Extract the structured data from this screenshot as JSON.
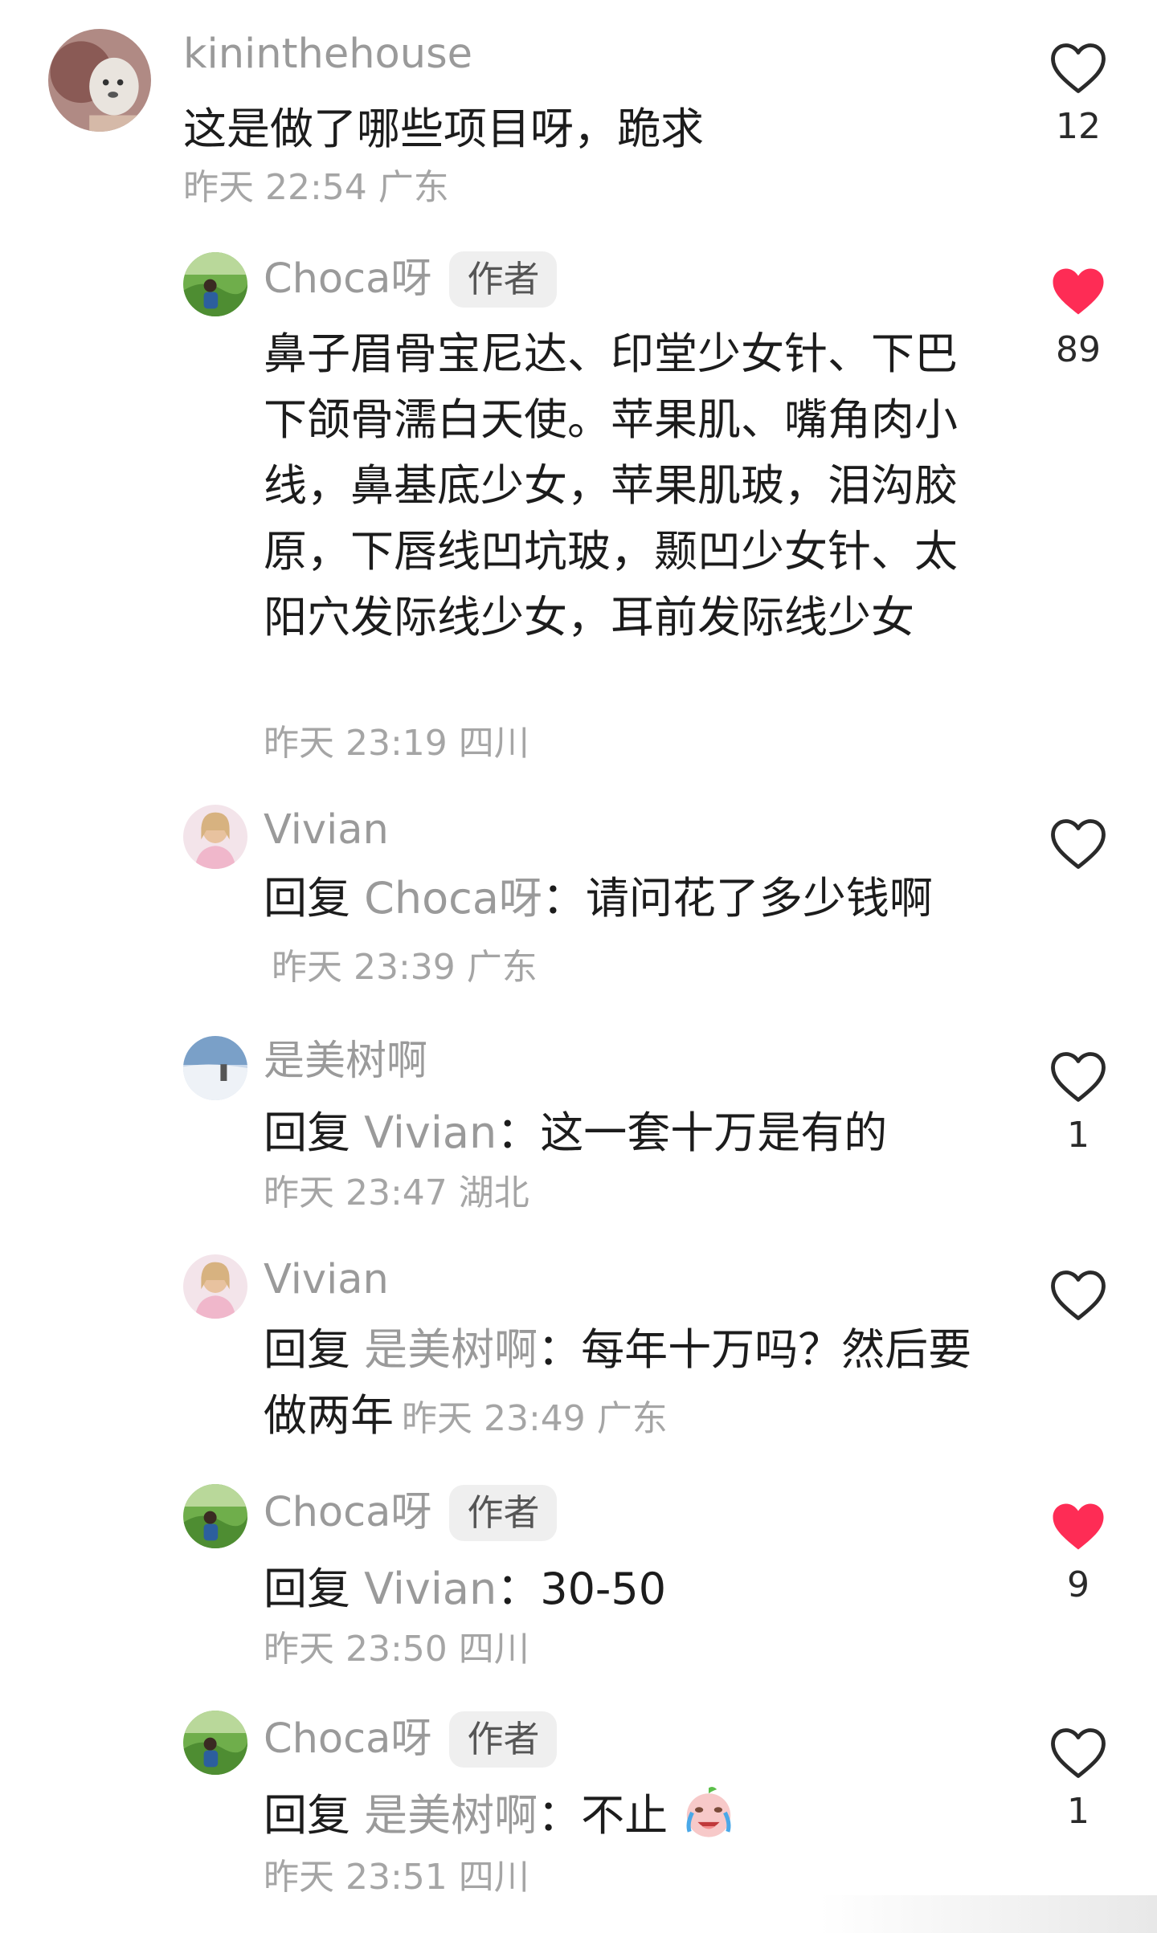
{
  "comments": [
    {
      "username": "kininthehouse",
      "text": "这是做了哪些项目呀，跪求",
      "time": "昨天 22:54 广东",
      "likes": "12",
      "liked": false,
      "avatar": "dog-avatar"
    },
    {
      "username": "Choca呀",
      "badge": "作者",
      "text": "鼻子眉骨宝尼达、印堂少女针、下巴下颌骨濡白天使。苹果肌、嘴角肉小线，鼻基底少女，苹果肌玻，泪沟胶原，下唇线凹坑玻，颞凹少女针、太阳穴发际线少女，耳前发际线少女",
      "time": "昨天 23:19 四川",
      "likes": "89",
      "liked": true,
      "avatar": "outdoor-avatar"
    },
    {
      "username": "Vivian",
      "reply_word": "回复",
      "reply_to": "Choca呀",
      "colon": "：",
      "text": "请问花了多少钱啊",
      "time": "昨天 23:39 广东",
      "likes": "",
      "liked": false,
      "avatar": "portrait-avatar"
    },
    {
      "username": "是美树啊",
      "reply_word": "回复",
      "reply_to": "Vivian",
      "colon": "：",
      "text": "这一套十万是有的",
      "time": "昨天 23:47 湖北",
      "likes": "1",
      "liked": false,
      "avatar": "sky-avatar"
    },
    {
      "username": "Vivian",
      "reply_word": "回复",
      "reply_to": "是美树啊",
      "colon": "：",
      "text": "每年十万吗？然后要做两年",
      "time": "昨天 23:49 广东",
      "likes": "",
      "liked": false,
      "avatar": "portrait-avatar"
    },
    {
      "username": "Choca呀",
      "badge": "作者",
      "reply_word": "回复",
      "reply_to": "Vivian",
      "colon": "：",
      "text": "30-50",
      "time": "昨天 23:50 四川",
      "likes": "9",
      "liked": true,
      "avatar": "outdoor-avatar"
    },
    {
      "username": "Choca呀",
      "badge": "作者",
      "reply_word": "回复",
      "reply_to": "是美树啊",
      "colon": "：",
      "text": "不止",
      "emoji": "crying-laughing-emoji",
      "time": "昨天 23:51 四川",
      "likes": "1",
      "liked": false,
      "avatar": "outdoor-avatar"
    }
  ],
  "colors": {
    "heart_liked": "#fe2c55",
    "heart_outline": "#2a2a2a",
    "muted_text": "#9a9a9a"
  }
}
